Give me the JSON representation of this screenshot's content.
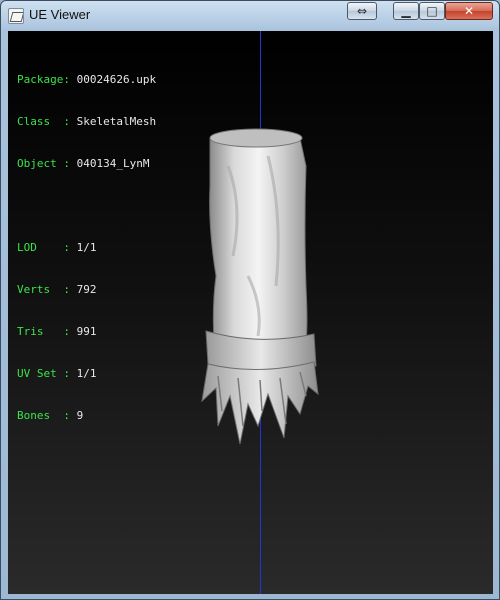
{
  "window": {
    "title": "UE Viewer",
    "icons": {
      "app": "ue-viewer-app-icon",
      "swap": "swap-arrows-icon",
      "minimize": "minimize-icon",
      "maximize": "maximize-icon",
      "close": "close-icon"
    },
    "buttons": {
      "swap": "⇔",
      "minimize": "▁",
      "maximize": "□",
      "close": "✕"
    }
  },
  "info": {
    "package_key": "Package: ",
    "package_val": "00024626.upk",
    "class_key": "Class  : ",
    "class_val": "SkeletalMesh",
    "object_key": "Object : ",
    "object_val": "040134_LynM",
    "lod_key": "LOD    : ",
    "lod_val": "1/1",
    "verts_key": "Verts  : ",
    "verts_val": "792",
    "tris_key": "Tris   : ",
    "tris_val": "991",
    "uvset_key": "UV Set : ",
    "uvset_val": "1/1",
    "bones_key": "Bones  : ",
    "bones_val": "9"
  },
  "colors": {
    "key_text": "#3be34a",
    "value_text": "#e8e8e8",
    "axis": "#2433d8"
  }
}
